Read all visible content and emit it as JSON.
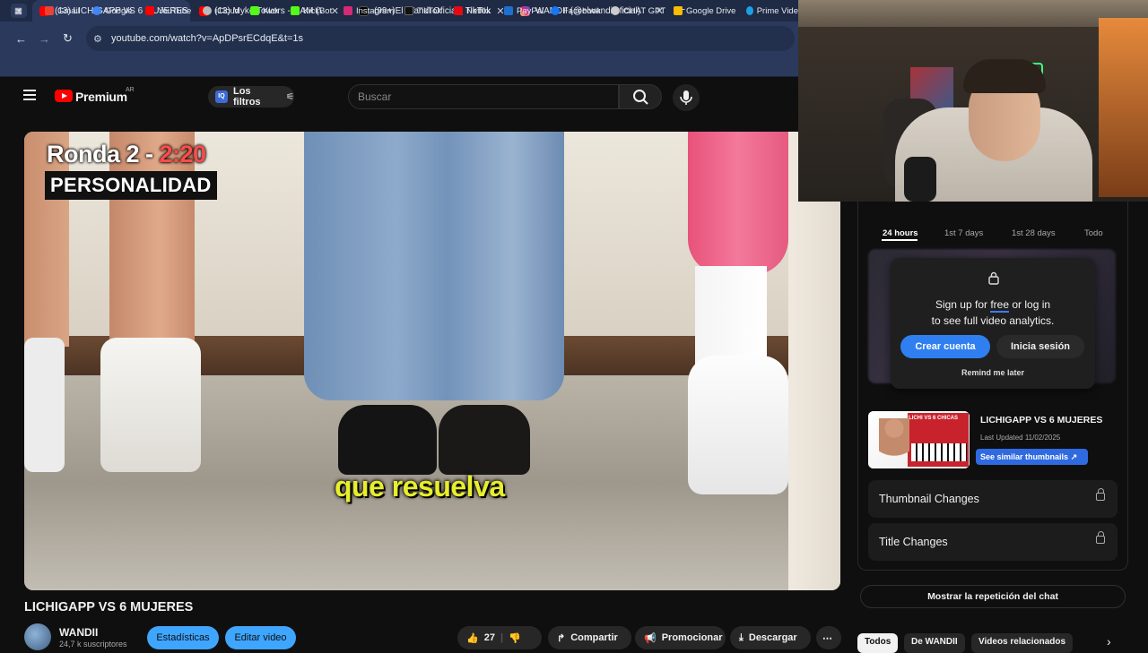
{
  "browser": {
    "tabs": [
      {
        "title": "(13) LICHIGAPP VS 6 MUJERES",
        "favicon": "youtube-icon",
        "color": "#ff0000",
        "active": true
      },
      {
        "title": "(13) Myke Towers - 3 AM (Visua",
        "favicon": "youtube-icon",
        "color": "#ff0000",
        "active": false
      },
      {
        "title": "(99+)El Wandi Oficial | TikTok",
        "favicon": "tiktok-icon",
        "color": "#111111",
        "active": false
      },
      {
        "title": "WANDII (@elwandiioficial) • Fot",
        "favicon": "instagram-icon",
        "color": "#d62976",
        "active": false
      }
    ],
    "url": "youtube.com/watch?v=ApDPsrECdqE&t=1s",
    "bookmarks": [
      {
        "label": "Gmail",
        "color": "#ea4335"
      },
      {
        "label": "Google",
        "color": "#4285f4"
      },
      {
        "label": "YouTube",
        "color": "#ff0000"
      },
      {
        "label": "iCloud",
        "color": "#bbbbbb"
      },
      {
        "label": "Kick",
        "color": "#53fc18"
      },
      {
        "label": "KickBot",
        "color": "#53fc18"
      },
      {
        "label": "Instagram",
        "color": "#d62976"
      },
      {
        "label": "TikTok",
        "color": "#111111"
      },
      {
        "label": "Netflix",
        "color": "#e50914"
      },
      {
        "label": "PayPal",
        "color": "#1f6fd0"
      },
      {
        "label": "Facebook",
        "color": "#1877f2"
      },
      {
        "label": "CHAT GPT",
        "color": "#cccccc"
      },
      {
        "label": "Google Drive",
        "color": "#fbbc04"
      },
      {
        "label": "Prime Vide",
        "color": "#1aa0e6"
      }
    ]
  },
  "youtube": {
    "brand": "Premium",
    "country": "AR",
    "filters_label": "Los filtros",
    "filters_badge": "IQ",
    "search_placeholder": "Buscar"
  },
  "video": {
    "overlay_round": "Ronda 2 -",
    "overlay_time": "2:20",
    "overlay_tag": "PERSONALIDAD",
    "subtitle": "que resuelva",
    "title": "LICHIGAPP VS 6 MUJERES",
    "channel_name": "WANDII",
    "channel_subs": "24,7 k suscriptores",
    "buttons": {
      "stats": "Estadísticas",
      "edit": "Editar video",
      "likes": "27",
      "share": "Compartir",
      "promote": "Promocionar",
      "download": "Descargar"
    }
  },
  "panel": {
    "tabs": [
      "24 hours",
      "1st 7 days",
      "1st 28 days",
      "Todo"
    ],
    "signup_line1_pre": "Sign up for ",
    "signup_free": "free",
    "signup_line1_post": " or log in",
    "signup_line2": "to see full video analytics.",
    "create_account": "Crear cuenta",
    "login": "Inicia sesión",
    "remind": "Remind me later",
    "thumb_title": "LICHIGAPP VS 6 MUJERES",
    "thumb_updated": "Last Updated 11/02/2025",
    "thumb_overlay": "LICHI VS 6 CHICAS",
    "similar_btn": "See similar thumbnails",
    "thumbnail_changes": "Thumbnail Changes",
    "title_changes": "Title Changes",
    "chat_replay": "Mostrar la repetición del chat",
    "chips": [
      "Todos",
      "De WANDII",
      "Videos relacionados"
    ]
  }
}
